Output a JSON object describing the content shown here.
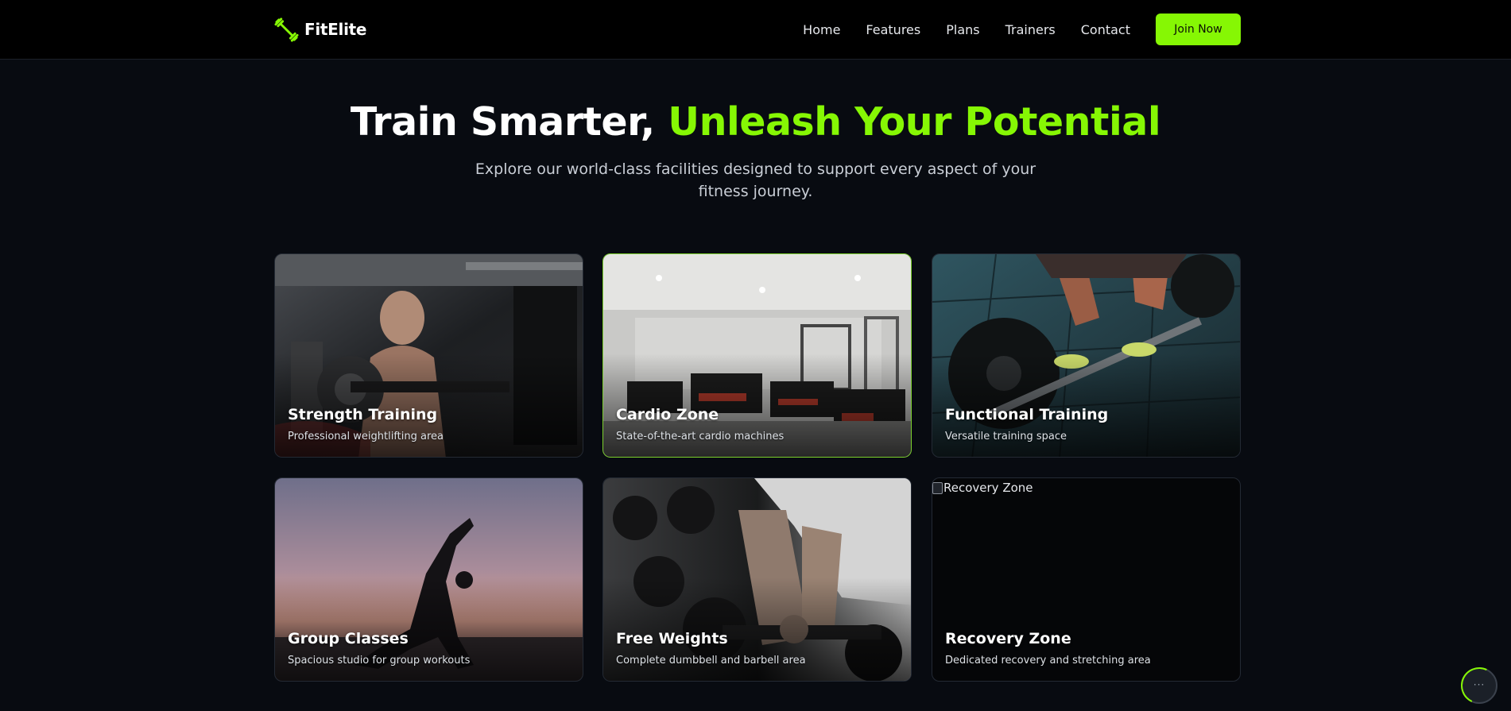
{
  "brand": {
    "name": "FitElite",
    "icon": "dumbbell-icon",
    "accent_color": "#86f704"
  },
  "nav": {
    "links": [
      "Home",
      "Features",
      "Plans",
      "Trainers",
      "Contact"
    ],
    "cta_label": "Join Now"
  },
  "hero": {
    "title_part1": "Train Smarter, ",
    "title_part2": "Unleash Your Potential",
    "subtitle": "Explore our world-class facilities designed to support every aspect of your fitness journey."
  },
  "facilities": [
    {
      "title": "Strength Training",
      "desc": "Professional weightlifting area"
    },
    {
      "title": "Cardio Zone",
      "desc": "State-of-the-art cardio machines"
    },
    {
      "title": "Functional Training",
      "desc": "Versatile training space"
    },
    {
      "title": "Group Classes",
      "desc": "Spacious studio for group workouts"
    },
    {
      "title": "Free Weights",
      "desc": "Complete dumbbell and barbell area"
    },
    {
      "title": "Recovery Zone",
      "desc": "Dedicated recovery and stretching area",
      "alt_text": "Recovery Zone"
    }
  ],
  "widget": {
    "label": "···"
  }
}
